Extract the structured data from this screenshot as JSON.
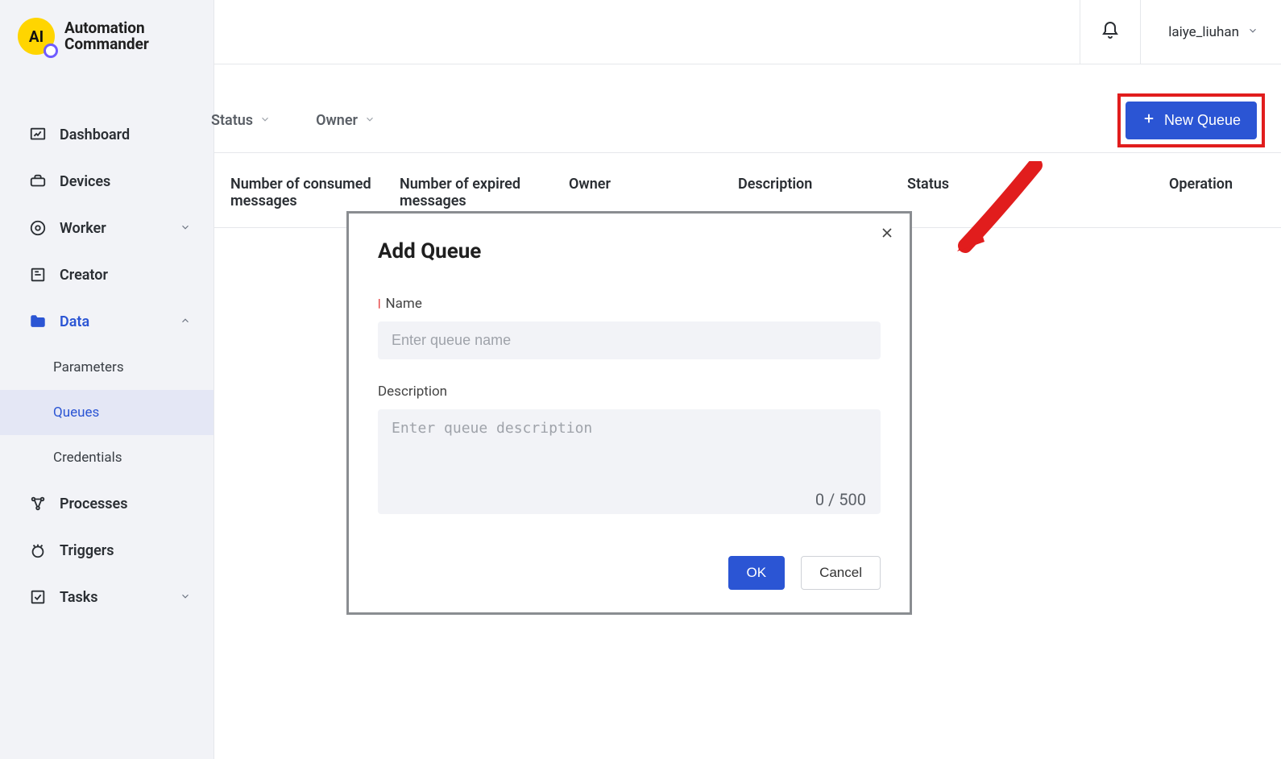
{
  "brand": {
    "name_line1": "Automation",
    "name_line2": "Commander",
    "badge_text": "AI"
  },
  "user": {
    "name": "laiye_liuhan"
  },
  "sidebar": {
    "items": [
      {
        "label": "Dashboard"
      },
      {
        "label": "Devices"
      },
      {
        "label": "Worker"
      },
      {
        "label": "Creator"
      },
      {
        "label": "Data"
      },
      {
        "label": "Processes"
      },
      {
        "label": "Triggers"
      },
      {
        "label": "Tasks"
      }
    ],
    "data_children": [
      {
        "label": "Parameters"
      },
      {
        "label": "Queues"
      },
      {
        "label": "Credentials"
      }
    ]
  },
  "filters": {
    "status_label": "Status",
    "owner_label": "Owner"
  },
  "new_queue_label": "New Queue",
  "table": {
    "headers": {
      "consumed": "Number of consumed messages",
      "expired": "Number of expired messages",
      "owner": "Owner",
      "description": "Description",
      "status": "Status",
      "operation": "Operation"
    }
  },
  "modal": {
    "title": "Add Queue",
    "name_label": "Name",
    "name_placeholder": "Enter queue name",
    "desc_label": "Description",
    "desc_placeholder": "Enter queue description",
    "char_count": "0 / 500",
    "ok": "OK",
    "cancel": "Cancel"
  }
}
